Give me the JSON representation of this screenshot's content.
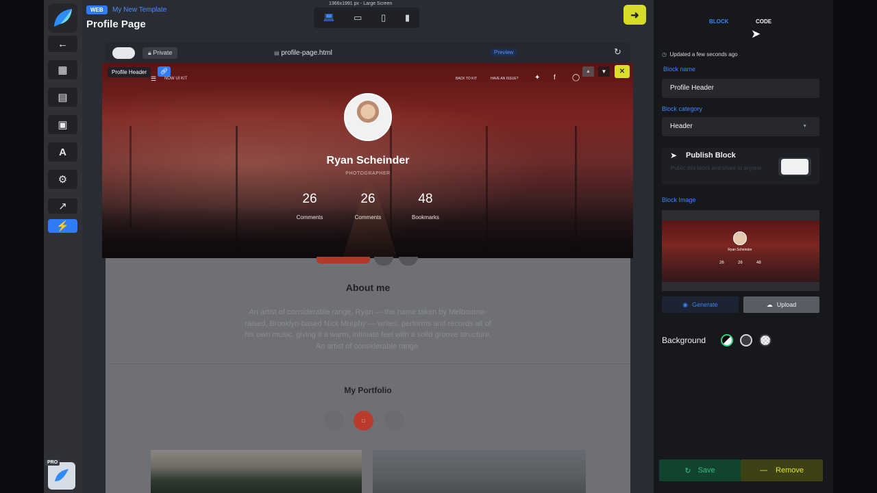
{
  "header": {
    "web_tag": "WEB",
    "template_name": "My New Template",
    "page_title": "Profile Page",
    "dimensions": "1366x1991 px - Large Screen"
  },
  "canvas_bar": {
    "visibility": "Private",
    "file": "profile-page.html",
    "preview": "Preview"
  },
  "hero": {
    "block_label": "Profile Header",
    "kit_name": "NOW UI KIT",
    "link_back": "BACK TO KIT",
    "link_issue": "HAVE AN ISSUE?",
    "name": "Ryan Scheinder",
    "role": "PHOTOGRAPHER",
    "stats": [
      {
        "value": "26",
        "label": "Comments"
      },
      {
        "value": "26",
        "label": "Comments"
      },
      {
        "value": "48",
        "label": "Bookmarks"
      }
    ]
  },
  "about": {
    "title": "About me",
    "text": "An artist of considerable range, Ryan — the name taken by Melbourne-raised, Brooklyn-based Nick Murphy — writes, performs and records all of his own music, giving it a warm, intimate feel with a solid groove structure. An artist of considerable range."
  },
  "portfolio": {
    "title": "My Portfolio"
  },
  "panel": {
    "tab_block": "BLOCK",
    "tab_code": "CODE",
    "updated": "Updated a few seconds ago",
    "block_name_label": "Block name",
    "block_name_value": "Profile Header",
    "block_category_label": "Block category",
    "block_category_value": "Header",
    "publish_title": "Publish Block",
    "publish_sub": "Public this block and share to anyone",
    "block_image_label": "Block Image",
    "generate": "Generate",
    "upload": "Upload",
    "background_label": "Background",
    "save": "Save",
    "remove": "Remove"
  },
  "colors": {
    "accent": "#2f7cf6",
    "yellow": "#d7dc27",
    "save_green": "#31c07c",
    "hero_red": "#7a2421"
  }
}
